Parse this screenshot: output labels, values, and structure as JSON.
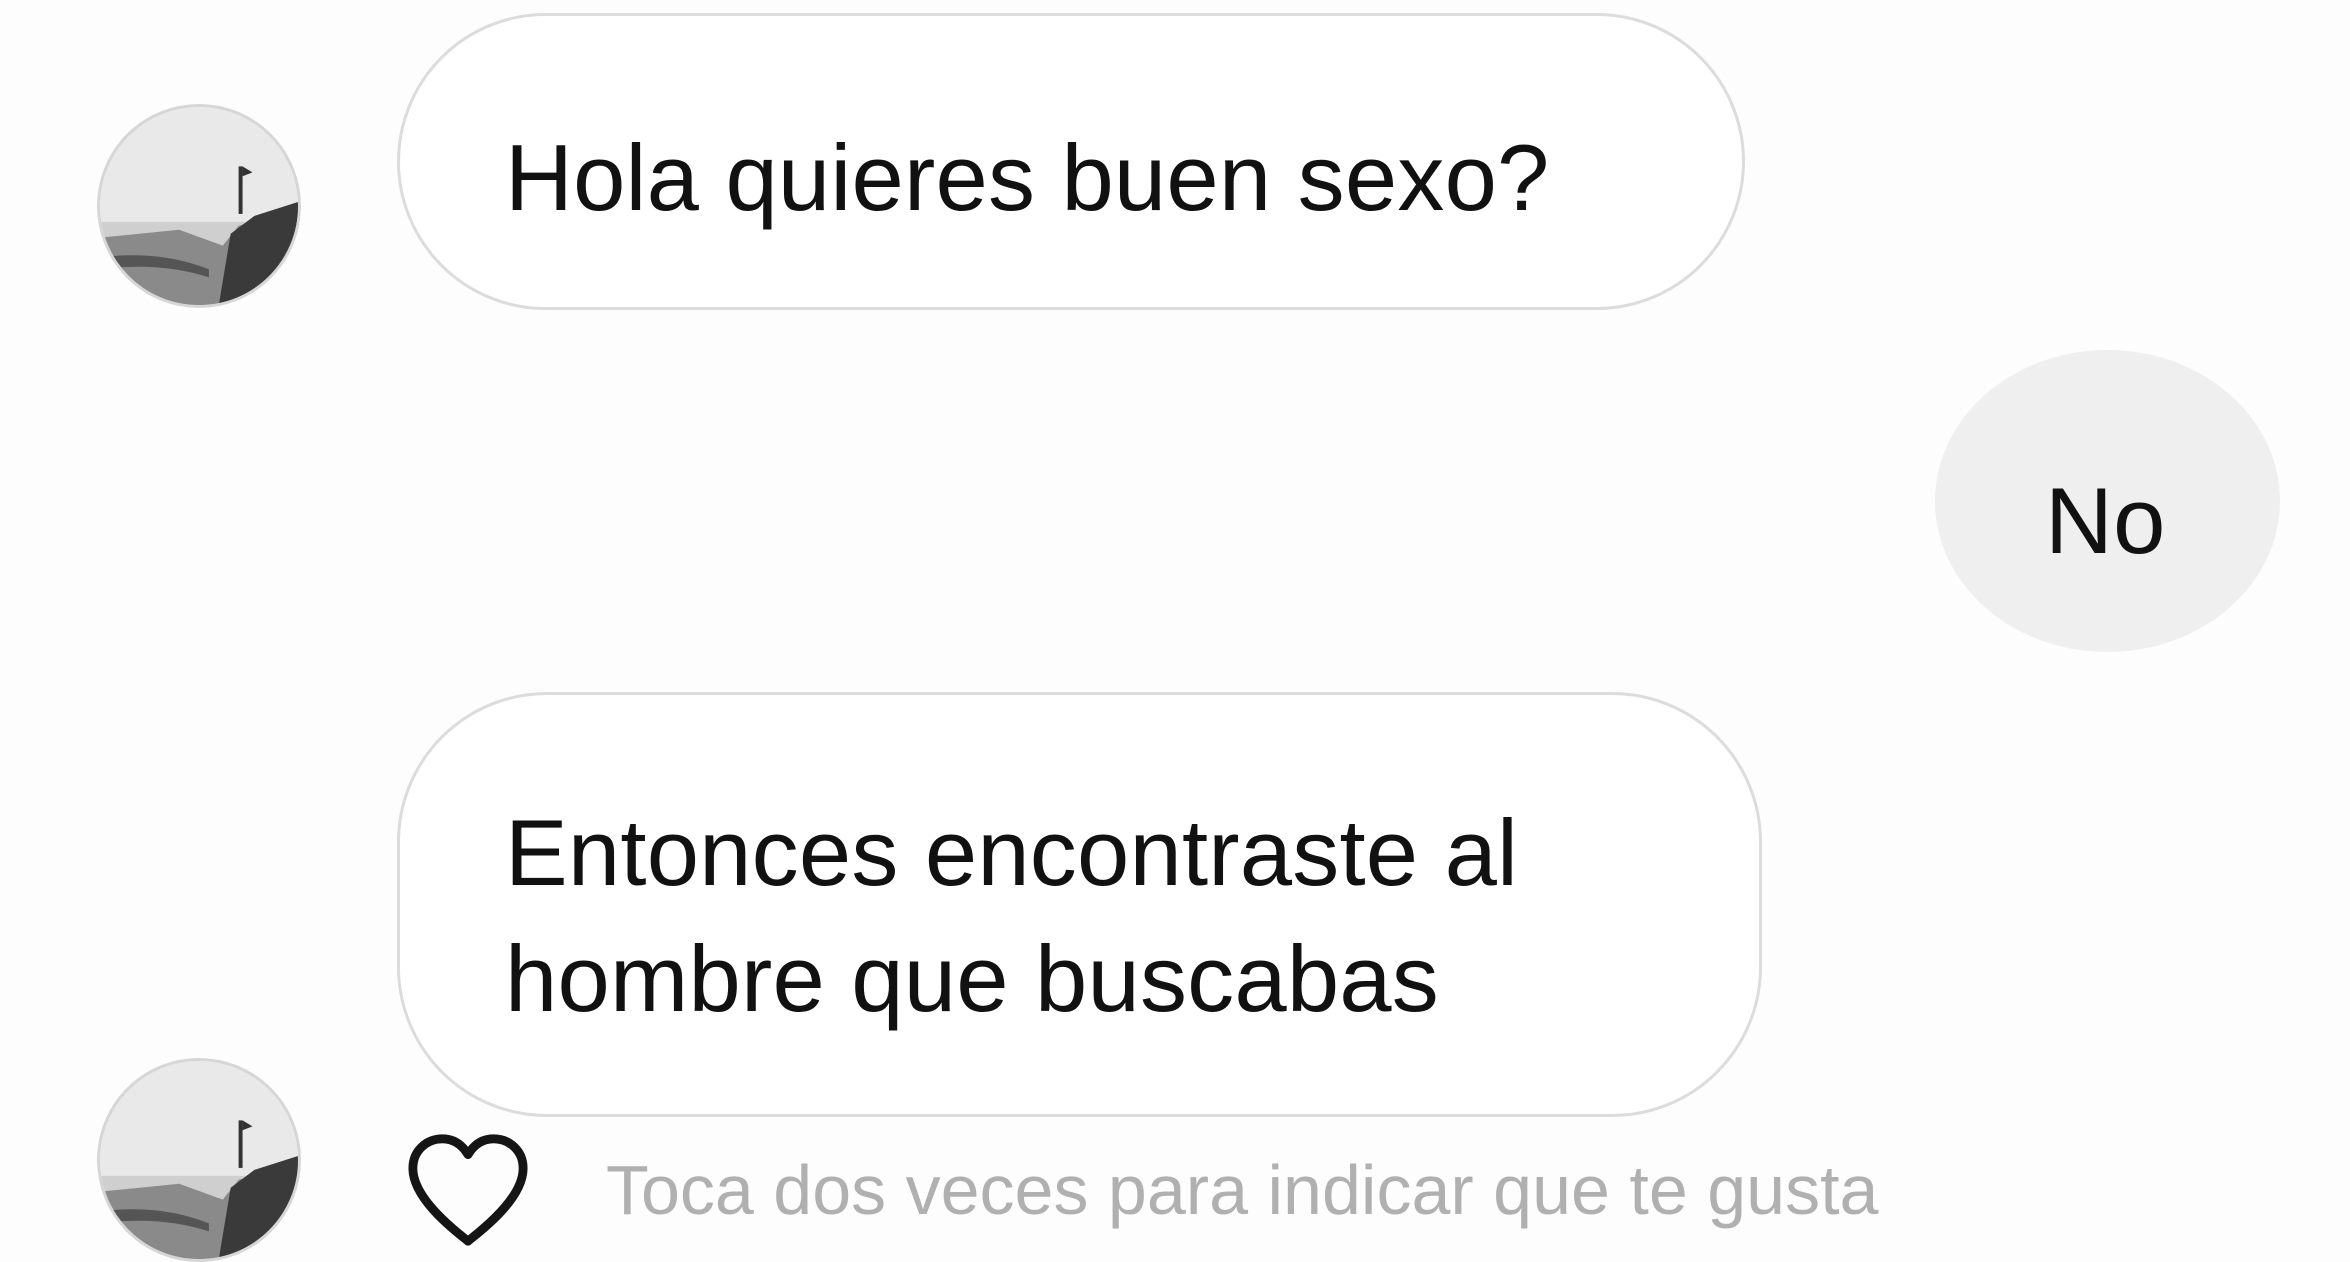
{
  "conversation": {
    "messages": [
      {
        "sender": "other",
        "text": "Hola quieres buen sexo?"
      },
      {
        "sender": "me",
        "text": "No"
      },
      {
        "sender": "other",
        "text": "Entonces encontraste al\nhombre que buscabas"
      }
    ],
    "like_hint": "Toca dos veces para indicar que te gusta",
    "like_icon": "heart-outline-icon",
    "colors": {
      "background": "#fdfdfd",
      "incoming_bubble": "#ffffff",
      "incoming_border": "#dcdcdc",
      "outgoing_bubble": "#efefef",
      "text": "#111111",
      "hint_text": "#b0b0b0"
    }
  }
}
